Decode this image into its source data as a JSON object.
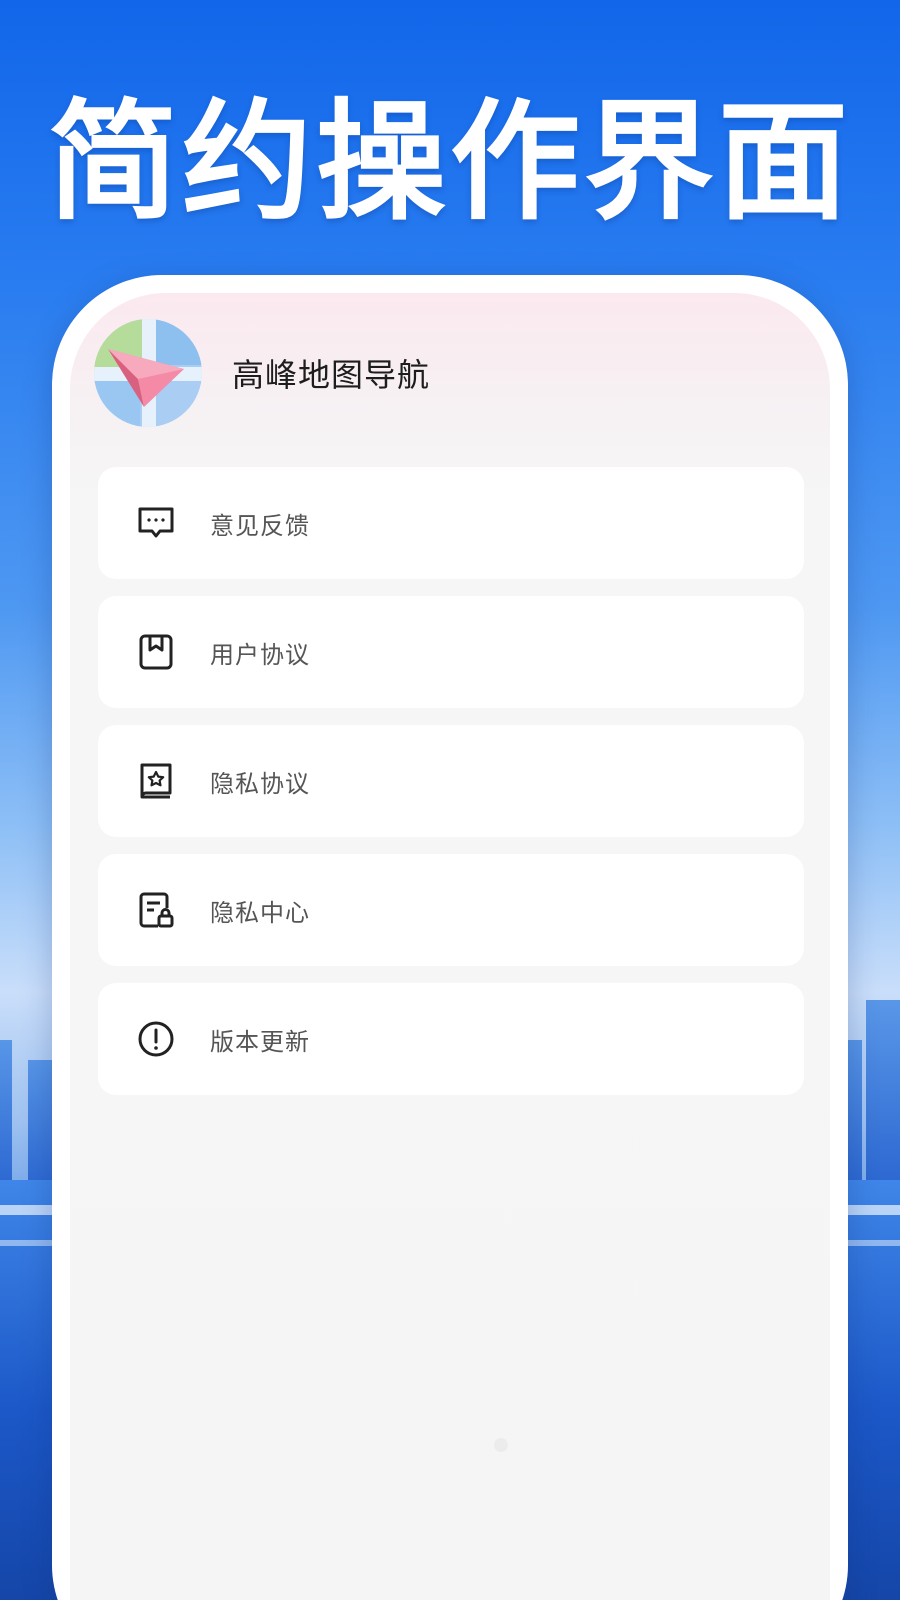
{
  "headline": "简约操作界面",
  "app": {
    "name": "高峰地图导航",
    "icon": "paper-plane-map-icon"
  },
  "menu": [
    {
      "label": "意见反馈",
      "icon": "chat-bubble-icon"
    },
    {
      "label": "用户协议",
      "icon": "bookmark-document-icon"
    },
    {
      "label": "隐私协议",
      "icon": "star-book-icon"
    },
    {
      "label": "隐私中心",
      "icon": "document-lock-icon"
    },
    {
      "label": "版本更新",
      "icon": "info-circle-icon"
    }
  ],
  "colors": {
    "background_blue": "#1166ea",
    "card": "#ffffff",
    "screen_bg": "#f5f5f5",
    "label_text": "#555555",
    "icon_stroke": "#222222"
  }
}
